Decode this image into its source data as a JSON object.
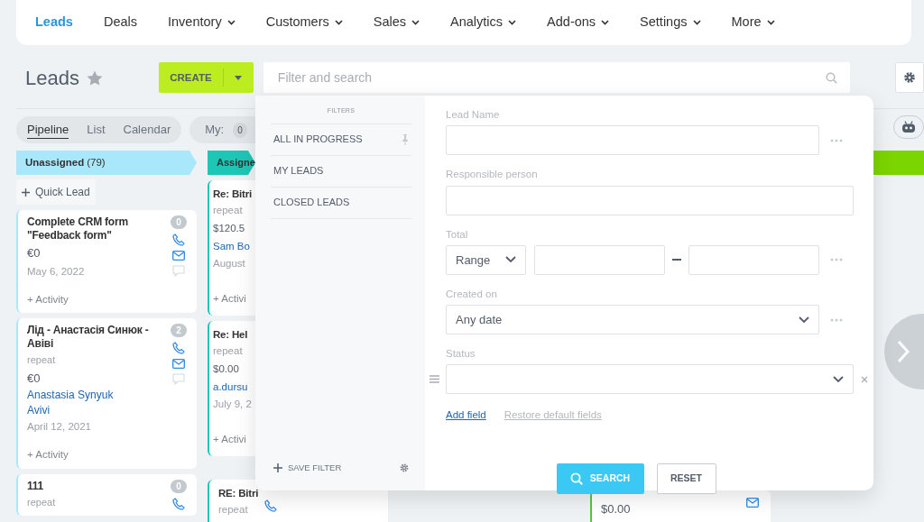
{
  "nav": {
    "items": [
      {
        "label": "Leads",
        "selected": true,
        "dropdown": false
      },
      {
        "label": "Deals",
        "selected": false,
        "dropdown": false
      },
      {
        "label": "Inventory",
        "selected": false,
        "dropdown": true
      },
      {
        "label": "Customers",
        "selected": false,
        "dropdown": true
      },
      {
        "label": "Sales",
        "selected": false,
        "dropdown": true
      },
      {
        "label": "Analytics",
        "selected": false,
        "dropdown": true
      },
      {
        "label": "Add-ons",
        "selected": false,
        "dropdown": true
      },
      {
        "label": "Settings",
        "selected": false,
        "dropdown": true
      },
      {
        "label": "More",
        "selected": false,
        "dropdown": true
      }
    ]
  },
  "header": {
    "title": "Leads",
    "create_button": "CREATE",
    "search": {
      "placeholder": "Filter and search"
    }
  },
  "view_tabs": [
    {
      "label": "Pipeline",
      "selected": true
    },
    {
      "label": "List",
      "selected": false
    },
    {
      "label": "Calendar",
      "selected": false
    }
  ],
  "my_filter": {
    "label": "My:",
    "count": "0"
  },
  "columns": [
    {
      "title": "Unassigned",
      "count": "(79)",
      "color": "#a9e7fa",
      "quick_lead": "Quick Lead",
      "cards": [
        {
          "title": "Complete CRM form \"Feedback form\"",
          "amount": "€0",
          "date": "May 6, 2022",
          "counter": "0",
          "activity": "+ Activity"
        },
        {
          "title": "Лід - Анастасія Синюк - Авіві",
          "subtitle": "repeat",
          "amount": "€0",
          "contact": [
            "Anastasia Synyuk",
            "Avivi"
          ],
          "date": "April 12, 2021",
          "counter": "2",
          "activity": "+ Activity"
        },
        {
          "title": "111",
          "subtitle": "repeat",
          "counter": "0"
        }
      ]
    },
    {
      "title": "Assigne",
      "color": "#1ec6b6",
      "cards": [
        {
          "title": "Re: Bitri",
          "subtitle": "repeat",
          "amount": "$120.5",
          "contact": [
            "Sam Bo"
          ],
          "date": "August",
          "activity": "+ Activi"
        },
        {
          "title": "Re: Hel",
          "subtitle": "repeat",
          "amount": "$0.00",
          "contact": [
            "a.dursu"
          ],
          "date": "July 9, 2",
          "activity": "+ Activi"
        },
        {
          "title": "RE: Bitri",
          "subtitle": "repeat",
          "phone": true
        }
      ]
    },
    {
      "color": "#55c53a",
      "cards": [
        {
          "amount": "$0.00",
          "mail": true
        }
      ]
    },
    {
      "color": "#7bd500"
    }
  ],
  "filter_popup": {
    "heading": "FILTERS",
    "presets": [
      {
        "label": "ALL IN PROGRESS",
        "pinned": true
      },
      {
        "label": "MY LEADS",
        "pinned": false
      },
      {
        "label": "CLOSED LEADS",
        "pinned": false
      }
    ],
    "save_filter": "SAVE FILTER",
    "fields": [
      {
        "label": "Lead Name",
        "kind": "text",
        "menu": true,
        "removable": false
      },
      {
        "label": "Responsible person",
        "kind": "text",
        "menu": false,
        "removable": false
      },
      {
        "label": "Total",
        "kind": "range",
        "value": "Range",
        "menu": true,
        "removable": false
      },
      {
        "label": "Created on",
        "kind": "select",
        "value": "Any date",
        "menu": true,
        "removable": false
      },
      {
        "label": "Status",
        "kind": "select",
        "menu": false,
        "removable": true
      }
    ],
    "add_field": "Add field",
    "restore_fields": "Restore default fields",
    "search_button": "SEARCH",
    "reset_button": "RESET"
  }
}
